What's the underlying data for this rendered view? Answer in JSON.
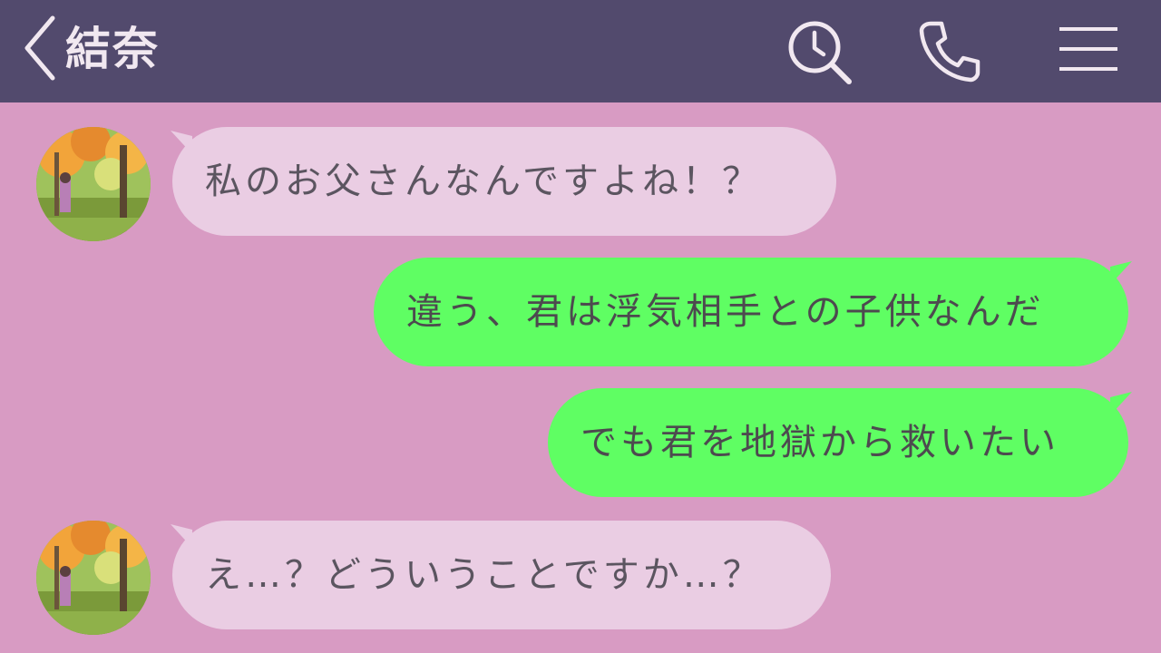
{
  "header": {
    "title": "結奈",
    "icons": [
      "back-chevron-icon",
      "search-clock-icon",
      "phone-icon",
      "menu-icon"
    ]
  },
  "colors": {
    "header_bg": "#524a6d",
    "chat_bg": "#d89bc3",
    "incoming_bubble": "#eacde3",
    "outgoing_bubble": "#5ffe63",
    "text": "#5b5560"
  },
  "messages": [
    {
      "from": "other",
      "text": "私のお父さんなんですよね！？"
    },
    {
      "from": "me",
      "text": "違う、君は浮気相手との子供なんだ"
    },
    {
      "from": "me",
      "text": "でも君を地獄から救いたい"
    },
    {
      "from": "other",
      "text": "え…？どういうことですか…？"
    }
  ]
}
